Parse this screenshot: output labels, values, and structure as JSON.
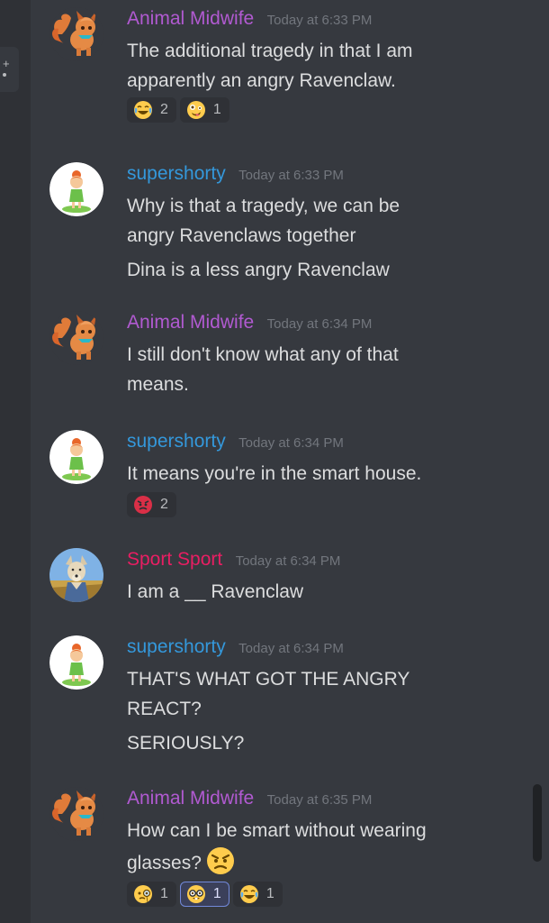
{
  "colors": {
    "animal_midwife": "#b15ad1",
    "supershorty": "#3498db",
    "sport_sport": "#e91e63",
    "background": "#36393f"
  },
  "rail": {
    "button_glyph": "+"
  },
  "messages": [
    {
      "author": "Animal Midwife",
      "timestamp": "Today at 6:33 PM",
      "lines": [
        "The additional tragedy in that I am",
        "apparently an angry Ravenclaw."
      ],
      "reactions": [
        {
          "emoji": "joy-emoji",
          "count": "2"
        },
        {
          "emoji": "zany-face-emoji",
          "count": "1"
        }
      ]
    },
    {
      "author": "supershorty",
      "timestamp": "Today at 6:33 PM",
      "lines": [
        "Why is that a tragedy, we can be",
        "angry Ravenclaws together",
        "Dina is a less angry Ravenclaw"
      ]
    },
    {
      "author": "Animal Midwife",
      "timestamp": "Today at 6:34 PM",
      "lines": [
        "I still don't know what any of that",
        "means."
      ]
    },
    {
      "author": "supershorty",
      "timestamp": "Today at 6:34 PM",
      "lines": [
        "It means you're in the smart house."
      ],
      "reactions": [
        {
          "emoji": "rage-emoji",
          "count": "2"
        }
      ]
    },
    {
      "author": "Sport Sport",
      "timestamp": "Today at 6:34 PM",
      "lines": [
        "I am a __ Ravenclaw"
      ]
    },
    {
      "author": "supershorty",
      "timestamp": "Today at 6:34 PM",
      "lines": [
        "THAT'S WHAT GOT THE ANGRY",
        "REACT?",
        "SERIOUSLY?"
      ]
    },
    {
      "author": "Animal Midwife",
      "timestamp": "Today at 6:35 PM",
      "lines": [
        "How can I be smart without wearing",
        "glasses?"
      ],
      "inline_emoji": "angry-face-emoji",
      "reactions": [
        {
          "emoji": "monocle-face-emoji",
          "count": "1"
        },
        {
          "emoji": "nerd-face-emoji",
          "count": "1",
          "me": true
        },
        {
          "emoji": "joy-emoji",
          "count": "1"
        }
      ]
    }
  ]
}
